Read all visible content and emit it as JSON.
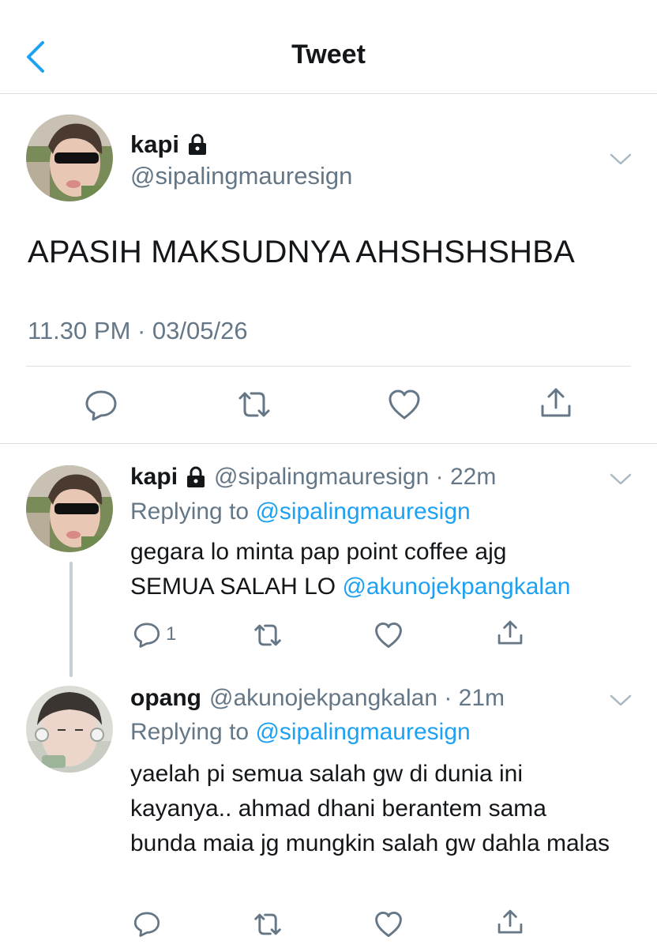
{
  "header": {
    "title": "Tweet"
  },
  "main_tweet": {
    "display_name": "kapi",
    "handle": "@sipalingmauresign",
    "text": "APASIH MAKSUDNYA AHSHSHSHBA",
    "timestamp": "11.30 PM · 03/05/26"
  },
  "replies": [
    {
      "display_name": "kapi",
      "handle_time": "@sipalingmauresign · 22m",
      "replying_prefix": "Replying to ",
      "replying_to": "@sipalingmauresign",
      "text_line1": "gegara lo minta pap point coffee ajg",
      "text_line2_plain": "SEMUA SALAH LO ",
      "text_line2_mention": "@akunojekpangkalan",
      "reply_count": "1"
    },
    {
      "display_name": "opang",
      "handle_time": "@akunojekpangkalan · 21m",
      "replying_prefix": "Replying to ",
      "replying_to": "@sipalingmauresign",
      "text": "yaelah pi semua salah gw di dunia ini kayanya.. ahmad dhani berantem sama bunda maia jg mungkin salah gw dahla malas"
    }
  ],
  "colors": {
    "accent": "#1da1f2",
    "secondary_text": "#657786",
    "primary_text": "#14171a",
    "divider": "#dcdfe2"
  },
  "icons": [
    "back-chevron-icon",
    "lock-icon",
    "chevron-down-icon",
    "reply-icon",
    "retweet-icon",
    "like-icon",
    "share-icon"
  ]
}
